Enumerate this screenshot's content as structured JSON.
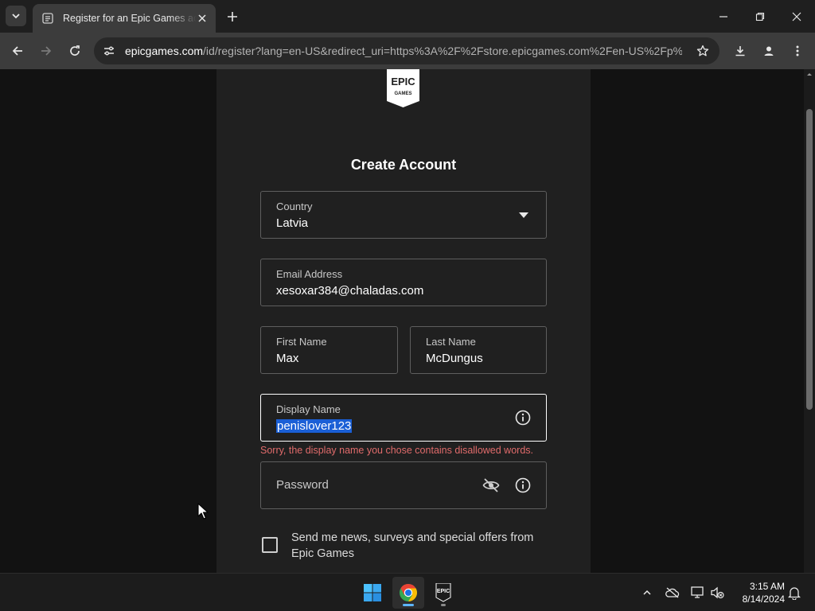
{
  "browser": {
    "tab_title": "Register for an Epic Games account",
    "url_host": "epicgames.com",
    "url_rest": "/id/register?lang=en-US&redirect_uri=https%3A%2F%2Fstore.epicgames.com%2Fen-US%2Fp%...",
    "logo_text_top": "EPIC",
    "logo_text_bottom": "GAMES"
  },
  "form": {
    "heading": "Create Account",
    "country": {
      "label": "Country",
      "value": "Latvia"
    },
    "email": {
      "label": "Email Address",
      "value": "xesoxar384@chaladas.com"
    },
    "first_name": {
      "label": "First Name",
      "value": "Max"
    },
    "last_name": {
      "label": "Last Name",
      "value": "McDungus"
    },
    "display_name": {
      "label": "Display Name",
      "value": "penislover123"
    },
    "display_name_error": "Sorry, the display name you chose contains disallowed words.",
    "password": {
      "placeholder": "Password"
    },
    "newsletter_label": "Send me news, surveys and special offers from Epic Games"
  },
  "taskbar": {
    "apps": [
      "start-icon",
      "chrome-icon",
      "epic-games-launcher-icon"
    ],
    "epic_app_text": "EPIC",
    "time": "3:15 AM",
    "date": "8/14/2024"
  },
  "colors": {
    "error": "#e06b6b",
    "selection": "#1a5fd6",
    "card_bg": "#202020",
    "page_bg": "#121212"
  }
}
